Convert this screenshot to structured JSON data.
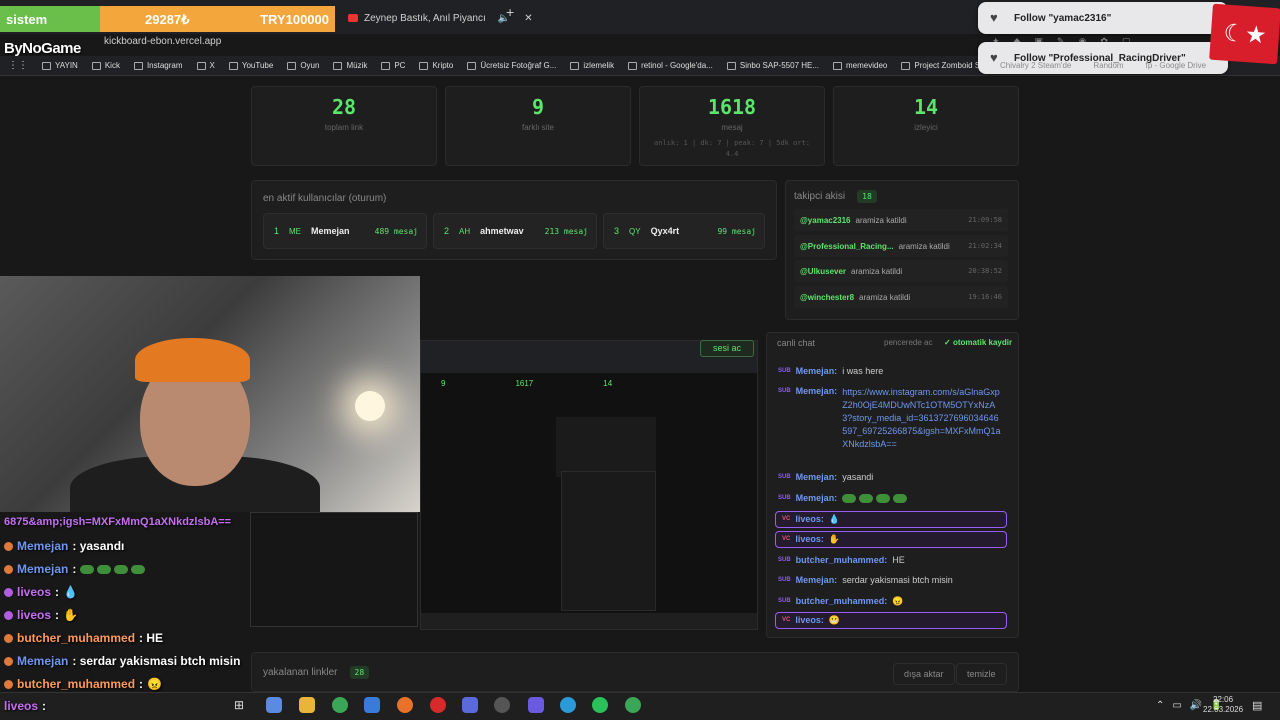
{
  "overlay_bar": {
    "label": "sistem",
    "counter": "29287₺",
    "goal": "TRY100000"
  },
  "tab": {
    "title": "Zeynep Bastık, Anıl Piyancı"
  },
  "address": {
    "url": "kickboard-ebon.vercel.app"
  },
  "brand": {
    "logo_text": "ByNoGame"
  },
  "bookmarks": [
    "YAYIN",
    "Kick",
    "Instagram",
    "X",
    "YouTube",
    "Oyun",
    "Müzik",
    "PC",
    "Kripto",
    "Ücretsiz Fotoğraf G...",
    "izlemelik",
    "retinol - Google'da...",
    "Sinbo SAP-5507 HE...",
    "memevideo",
    "Project Zomboid St..."
  ],
  "notifications": [
    "Follow \"yamac2316\"",
    "Follow \"Professional_RacingDriver\""
  ],
  "faded_bookmarks": [
    "Chivalry 2 Steam'de",
    "Random",
    "fp - Google Drive"
  ],
  "stats": [
    {
      "value": "28",
      "label": "toplam link"
    },
    {
      "value": "9",
      "label": "farklı site"
    },
    {
      "value": "1618",
      "label": "mesaj",
      "sub": "anlık: 1 | dk: 7 | peak: 7 | 5dk ort: 4.4"
    },
    {
      "value": "14",
      "label": "izleyici"
    }
  ],
  "active_users": {
    "title": "en aktif kullanıcılar (oturum)",
    "items": [
      {
        "rank": "1",
        "initials": "ME",
        "name": "Memejan",
        "count": "489 mesaj"
      },
      {
        "rank": "2",
        "initials": "AH",
        "name": "ahmetwav",
        "count": "213 mesaj"
      },
      {
        "rank": "3",
        "initials": "QY",
        "name": "Qyx4rt",
        "count": "99 mesaj"
      }
    ]
  },
  "followers": {
    "title": "takipci akisi",
    "count": "18",
    "items": [
      {
        "name": "@yamac2316",
        "action": "aramiza katildi",
        "time": "21:09:58"
      },
      {
        "name": "@Professional_Racing...",
        "action": "aramiza katildi",
        "time": "21:02:34"
      },
      {
        "name": "@Ulkusever",
        "action": "aramiza katildi",
        "time": "20:38:52"
      },
      {
        "name": "@winchester8",
        "action": "aramiza katildi",
        "time": "19:16:46"
      }
    ]
  },
  "live_chat": {
    "title": "canli chat",
    "popout": "pencerede ac",
    "autoscroll": "otomatik kaydir",
    "sound": "sesi ac",
    "messages": [
      {
        "badge": "SUB",
        "user": "Memejan:",
        "text": "i was here"
      },
      {
        "badge": "SUB",
        "user": "Memejan:",
        "text": "https://www.instagram.com/s/aGlnaGxpZ2h0OjE4MDUwNTc1OTM5OTYxNzA3?story_media_id=3613727696034646597_69725266875&igsh=MXFxMmQ1aXNkdzlsbA=="
      },
      {
        "badge": "SUB",
        "user": "Memejan:",
        "text": "yasandi"
      },
      {
        "badge": "SUB",
        "user": "Memejan:",
        "text": ""
      },
      {
        "badge": "VC",
        "user": "liveos:",
        "text": ""
      },
      {
        "badge": "VC",
        "user": "liveos:",
        "text": ""
      },
      {
        "badge": "SUB",
        "user": "butcher_muhammed:",
        "text": "HE"
      },
      {
        "badge": "SUB",
        "user": "Memejan:",
        "text": "serdar yakismasi btch misin"
      },
      {
        "badge": "SUB",
        "user": "butcher_muhammed:",
        "text": ""
      },
      {
        "badge": "VC",
        "user": "liveos:",
        "text": ""
      }
    ]
  },
  "overlay_chat": {
    "fragment": "6875&amp;igsh=MXFxMmQ1aXNkdzlsbA==",
    "rows": [
      {
        "user": "Memejan",
        "text": ": yasandı"
      },
      {
        "user": "Memejan",
        "text": ":"
      },
      {
        "user": "liveos",
        "text": ":"
      },
      {
        "user": "liveos",
        "text": ":"
      },
      {
        "user": "butcher_muhammed",
        "text": ": HE"
      },
      {
        "user": "Memejan",
        "text": ": serdar yakismasi btch misin"
      },
      {
        "user": "butcher_muhammed",
        "text": ":"
      },
      {
        "user": "liveos",
        "text": ":"
      }
    ]
  },
  "links": {
    "title": "yakalanan linkler",
    "count": "28",
    "export": "dışa aktar",
    "clear": "temizle"
  },
  "clock": {
    "time": "22:06",
    "date": "22.03.2026"
  },
  "colors": {
    "accent_green": "#5be56b",
    "username_blue": "#6f97f0",
    "highlight_purple": "#9b5cf6"
  }
}
